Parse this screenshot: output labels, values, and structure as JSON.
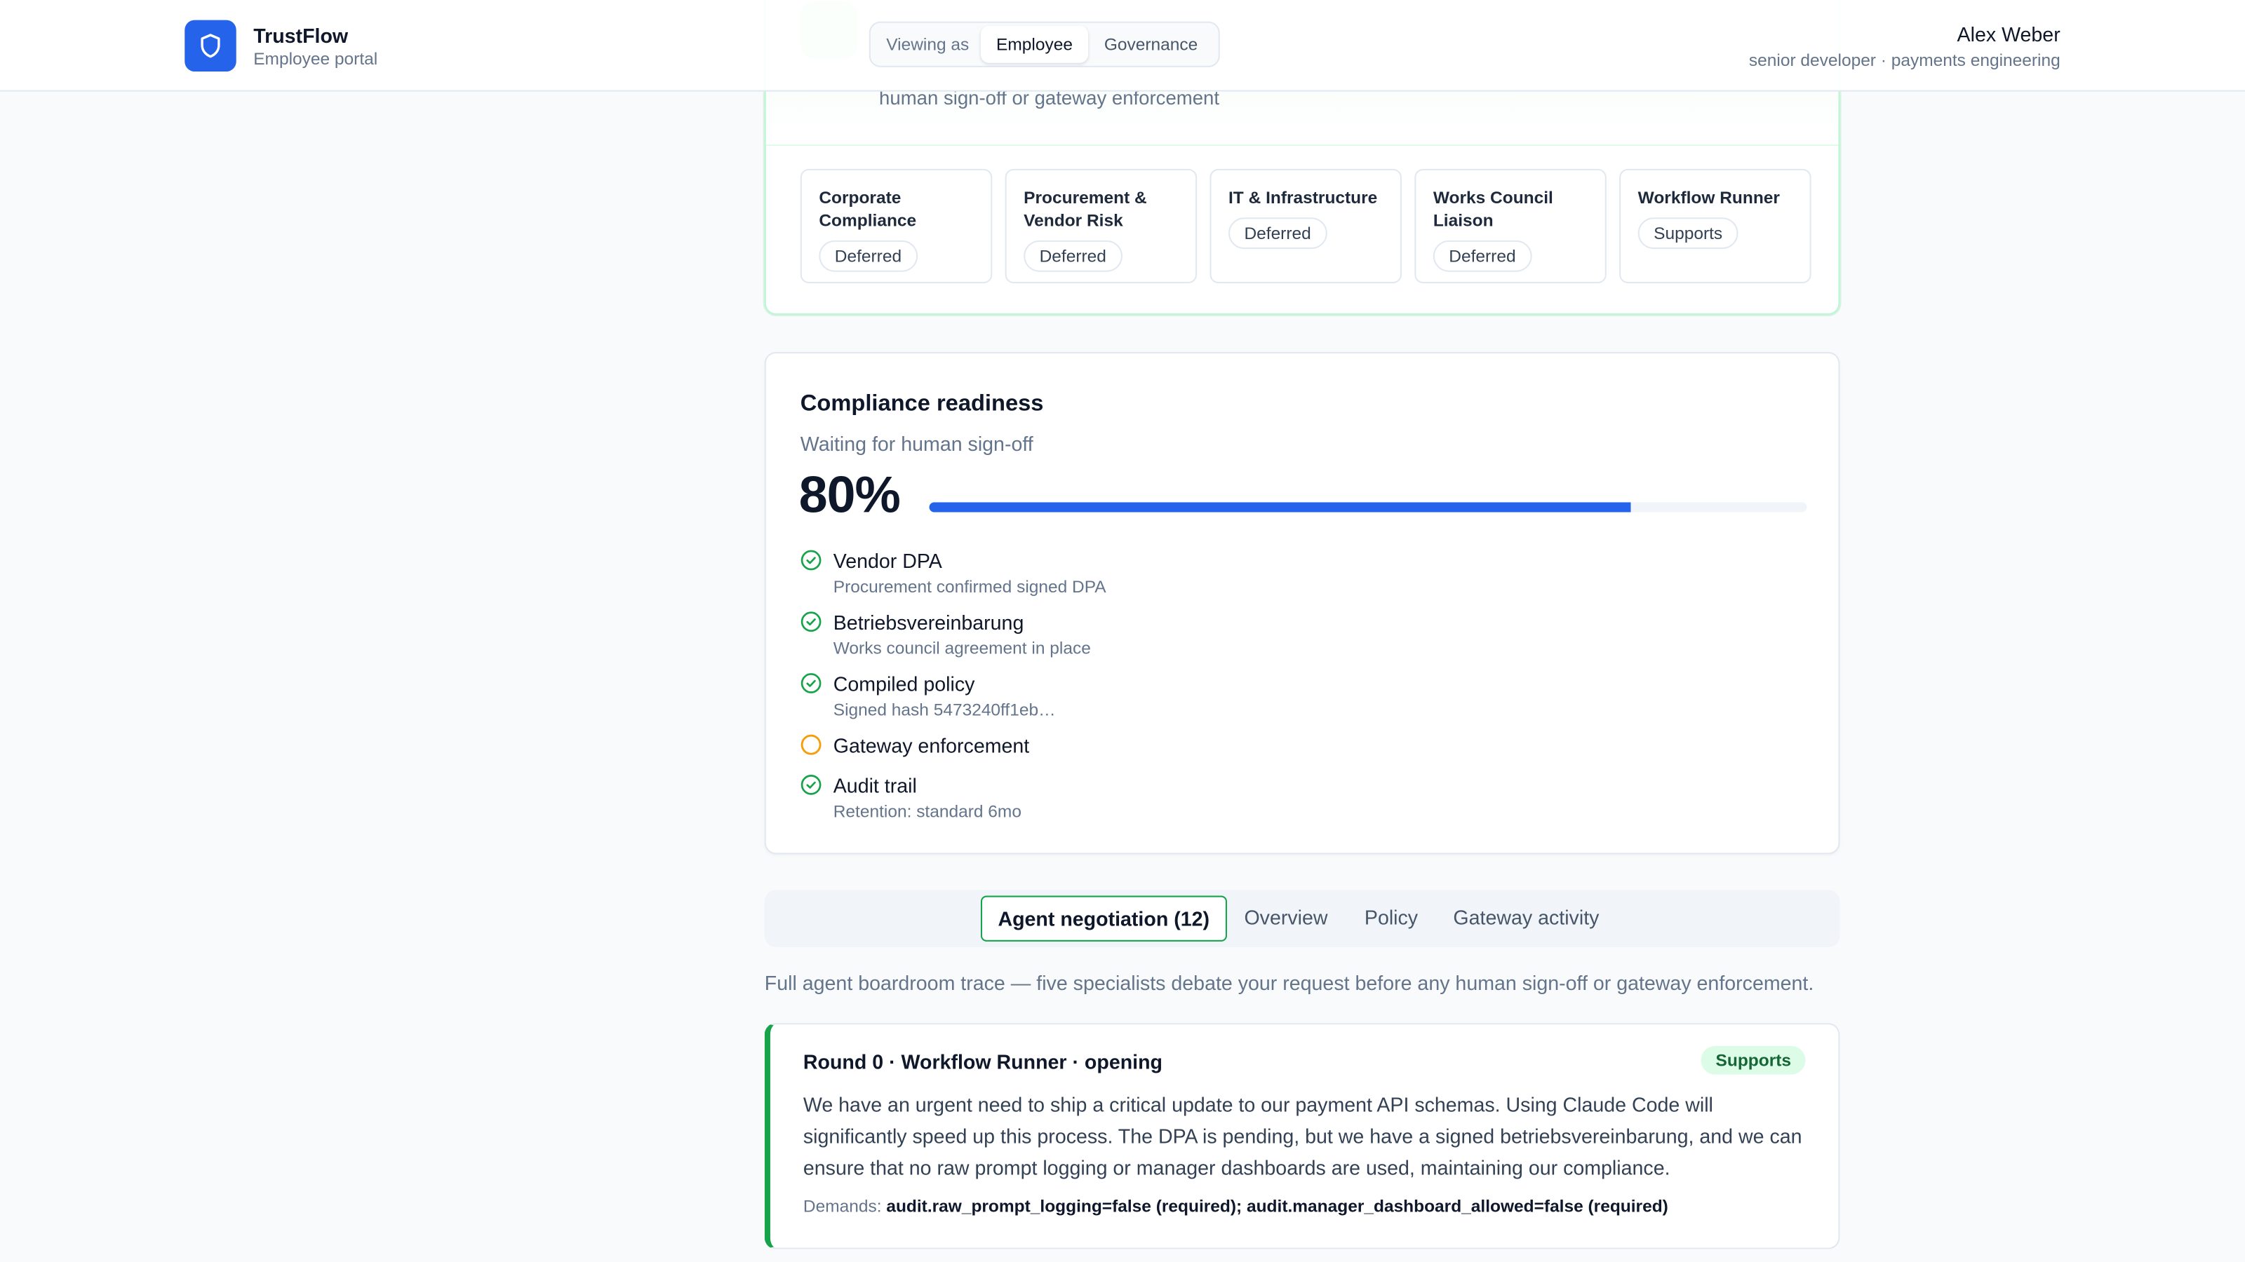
{
  "header": {
    "brand_name": "TrustFlow",
    "brand_sub": "Employee portal",
    "viewing_as_label": "Viewing as",
    "view_options": [
      "Employee",
      "Governance"
    ],
    "active_view": "Employee",
    "user_name": "Alex Weber",
    "user_role": "senior developer · payments engineering"
  },
  "hero": {
    "description_tail": "human sign-off or gateway enforcement",
    "agents": [
      {
        "name": "Corporate Compliance",
        "status": "Deferred"
      },
      {
        "name": "Procurement & Vendor Risk",
        "status": "Deferred"
      },
      {
        "name": "IT & Infrastructure",
        "status": "Deferred"
      },
      {
        "name": "Works Council Liaison",
        "status": "Deferred"
      },
      {
        "name": "Workflow Runner",
        "status": "Supports"
      }
    ]
  },
  "compliance": {
    "title": "Compliance readiness",
    "subtitle": "Waiting for human sign-off",
    "percent_label": "80%",
    "progress": 0.8,
    "items": [
      {
        "label": "Vendor DPA",
        "detail": "Procurement confirmed signed DPA",
        "state": "done"
      },
      {
        "label": "Betriebsvereinbarung",
        "detail": "Works council agreement in place",
        "state": "done"
      },
      {
        "label": "Compiled policy",
        "detail": "Signed hash 5473240ff1eb…",
        "state": "done"
      },
      {
        "label": "Gateway enforcement",
        "detail": "",
        "state": "pending"
      },
      {
        "label": "Audit trail",
        "detail": "Retention: standard 6mo",
        "state": "done"
      }
    ]
  },
  "tabs": {
    "items": [
      "Agent negotiation (12)",
      "Overview",
      "Policy",
      "Gateway activity"
    ],
    "active": "Agent negotiation (12)",
    "caption": "Full agent boardroom trace — five specialists debate your request before any human sign-off or gateway enforcement."
  },
  "round": {
    "title": "Round 0 · Workflow Runner · opening",
    "badge": "Supports",
    "body": "We have an urgent need to ship a critical update to our payment API schemas. Using Claude Code will significantly speed up this process. The DPA is pending, but we have a signed betriebsvereinbarung, and we can ensure that no raw prompt logging or manager dashboards are used, maintaining our compliance.",
    "demands_label": "Demands:",
    "demands_value": "audit.raw_prompt_logging=false (required); audit.manager_dashboard_allowed=false (required)"
  },
  "colors": {
    "accent": "#2563eb",
    "success": "#16a34a",
    "pending": "#f59e0b"
  }
}
